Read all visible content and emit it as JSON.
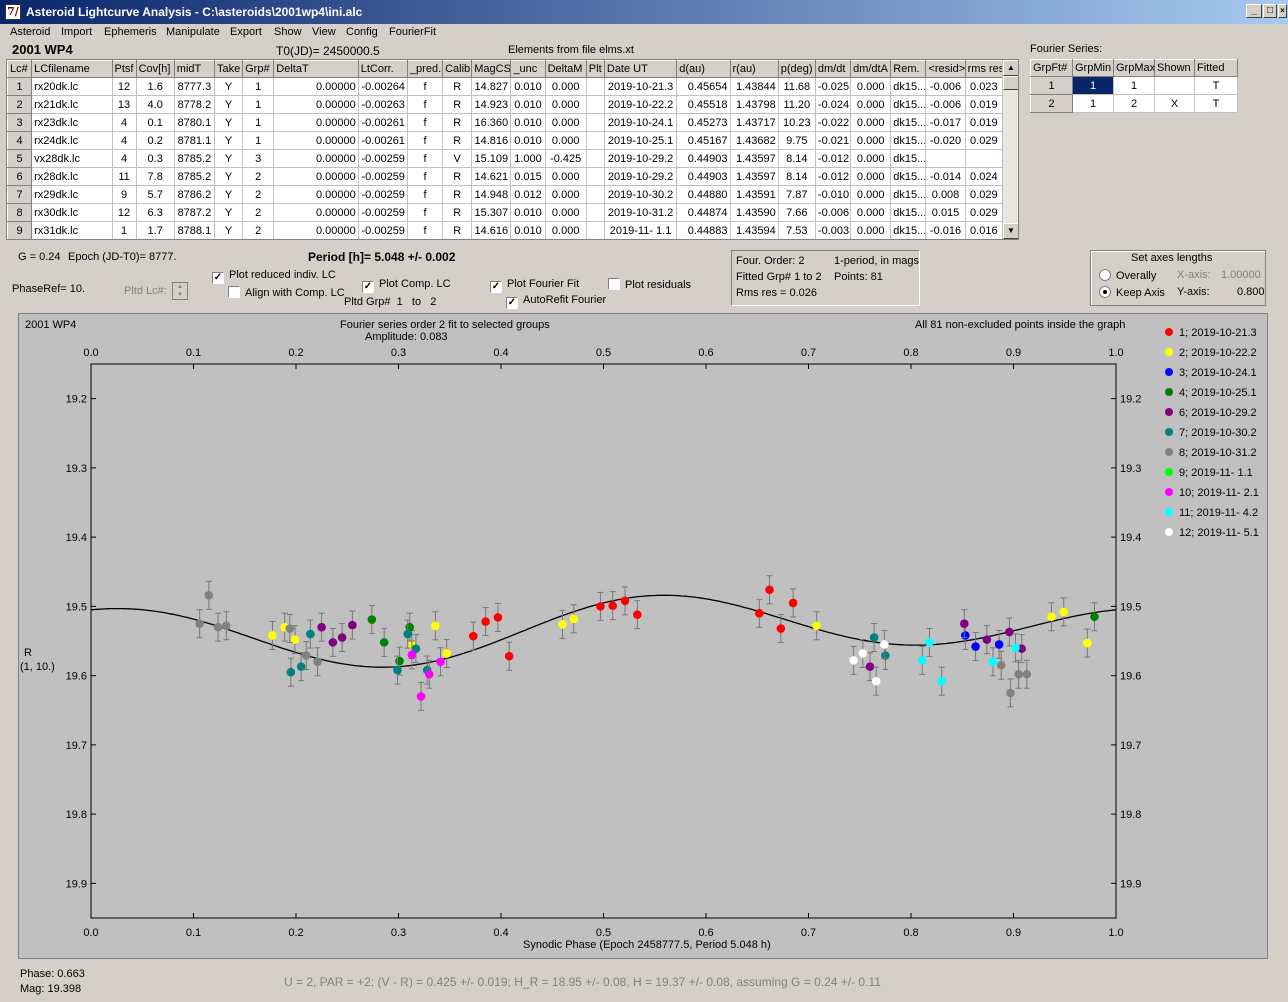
{
  "window": {
    "title": "Asteroid Lightcurve Analysis - C:\\asteroids\\2001wp4\\ini.alc",
    "icon_text": "7/"
  },
  "menu": [
    "Asteroid",
    "Import",
    "Ephemeris",
    "Manipulate",
    "Export",
    "Show",
    "View",
    "Config",
    "FourierFit"
  ],
  "header": {
    "asteroid": "2001 WP4",
    "t0": "T0(JD)= 2450000.5",
    "elements": "Elements from file elms.xt",
    "fourier_series_label": "Fourier Series:"
  },
  "lc_table": {
    "columns": [
      "Lc#",
      "LCfilename",
      "Ptsf",
      "Cov[h]",
      "midT",
      "Take",
      "Grp#",
      "DeltaT",
      "LtCorr.",
      "_pred.",
      "Calib.",
      "MagCS",
      "_unc",
      "DeltaM",
      "Plt",
      "Date UT",
      "d(au)",
      "r(au)",
      "p(deg)",
      "dm/dt",
      "dm/dtA",
      "Rem.",
      "<resid>",
      "rms res"
    ],
    "rows": [
      [
        "1",
        "rx20dk.lc",
        "12",
        "1.6",
        "8777.3",
        "Y",
        "1",
        "0.00000",
        "-0.00264",
        "f",
        "R",
        "14.827",
        "0.010",
        "0.000",
        "",
        "2019-10-21.3",
        "0.45654",
        "1.43844",
        "11.68",
        "-0.025",
        "0.000",
        "dk15...",
        "-0.006",
        "0.023"
      ],
      [
        "2",
        "rx21dk.lc",
        "13",
        "4.0",
        "8778.2",
        "Y",
        "1",
        "0.00000",
        "-0.00263",
        "f",
        "R",
        "14.923",
        "0.010",
        "0.000",
        "",
        "2019-10-22.2",
        "0.45518",
        "1.43798",
        "11.20",
        "-0.024",
        "0.000",
        "dk15...",
        "-0.006",
        "0.019"
      ],
      [
        "3",
        "rx23dk.lc",
        "4",
        "0.1",
        "8780.1",
        "Y",
        "1",
        "0.00000",
        "-0.00261",
        "f",
        "R",
        "16.360",
        "0.010",
        "0.000",
        "",
        "2019-10-24.1",
        "0.45273",
        "1.43717",
        "10.23",
        "-0.022",
        "0.000",
        "dk15...",
        "-0.017",
        "0.019"
      ],
      [
        "4",
        "rx24dk.lc",
        "4",
        "0.2",
        "8781.1",
        "Y",
        "1",
        "0.00000",
        "-0.00261",
        "f",
        "R",
        "14.816",
        "0.010",
        "0.000",
        "",
        "2019-10-25.1",
        "0.45167",
        "1.43682",
        "9.75",
        "-0.021",
        "0.000",
        "dk15...",
        "-0.020",
        "0.029"
      ],
      [
        "5",
        "vx28dk.lc",
        "4",
        "0.3",
        "8785.2",
        "Y",
        "3",
        "0.00000",
        "-0.00259",
        "f",
        "V",
        "15.109",
        "1.000",
        "-0.425",
        "",
        "2019-10-29.2",
        "0.44903",
        "1.43597",
        "8.14",
        "-0.012",
        "0.000",
        "dk15...",
        "",
        ""
      ],
      [
        "6",
        "rx28dk.lc",
        "11",
        "7.8",
        "8785.2",
        "Y",
        "2",
        "0.00000",
        "-0.00259",
        "f",
        "R",
        "14.621",
        "0.015",
        "0.000",
        "",
        "2019-10-29.2",
        "0.44903",
        "1.43597",
        "8.14",
        "-0.012",
        "0.000",
        "dk15...",
        "-0.014",
        "0.024"
      ],
      [
        "7",
        "rx29dk.lc",
        "9",
        "5.7",
        "8786.2",
        "Y",
        "2",
        "0.00000",
        "-0.00259",
        "f",
        "R",
        "14.948",
        "0.012",
        "0.000",
        "",
        "2019-10-30.2",
        "0.44880",
        "1.43591",
        "7.87",
        "-0.010",
        "0.000",
        "dk15...",
        "0.008",
        "0.029"
      ],
      [
        "8",
        "rx30dk.lc",
        "12",
        "6.3",
        "8787.2",
        "Y",
        "2",
        "0.00000",
        "-0.00259",
        "f",
        "R",
        "15.307",
        "0.010",
        "0.000",
        "",
        "2019-10-31.2",
        "0.44874",
        "1.43590",
        "7.66",
        "-0.006",
        "0.000",
        "dk15...",
        "0.015",
        "0.029"
      ],
      [
        "9",
        "rx31dk.lc",
        "1",
        "1.7",
        "8788.1",
        "Y",
        "2",
        "0.00000",
        "-0.00259",
        "f",
        "R",
        "14.616",
        "0.010",
        "0.000",
        "",
        "2019-11- 1.1",
        "0.44883",
        "1.43594",
        "7.53",
        "-0.003",
        "0.000",
        "dk15...",
        "-0.016",
        "0.016"
      ]
    ]
  },
  "fourier_table": {
    "columns": [
      "GrpFt#",
      "GrpMin",
      "GrpMax",
      "Shown",
      "Fitted"
    ],
    "rows": [
      [
        "1",
        "1",
        "1",
        "",
        "T"
      ],
      [
        "2",
        "1",
        "2",
        "X",
        "T"
      ]
    ]
  },
  "controls": {
    "g_text": "G = 0.24",
    "epoch_text": "Epoch (JD-T0)= 8777.",
    "period_text": "Period [h]= 5.048 +/- 0.002",
    "phaseref_text": "PhaseRef= 10.",
    "pltd_lc_label": "Pltd Lc#:",
    "plot_reduced": "Plot reduced indiv. LC",
    "align_comp": "Align with Comp. LC",
    "plot_comp": "Plot Comp. LC",
    "pltd_grp": "Pltd Grp#",
    "grp_from": "1",
    "grp_to_label": "to",
    "grp_to": "2",
    "plot_fourier": "Plot Fourier Fit",
    "autorefit": "AutoRefit Fourier",
    "plot_residuals": "Plot residuals"
  },
  "fourier_info": {
    "order": "Four. Order:  2",
    "period_mode": "1-period, in mags",
    "fitted_grp": "Fitted Grp# 1 to 2",
    "points": "Points: 81",
    "rms": "Rms res      = 0.026"
  },
  "axes_box": {
    "title": "Set axes lengths",
    "overally": "Overally",
    "keep_axis": "Keep Axis",
    "x_axis_label": "X-axis:",
    "x_axis_value": "1.00000",
    "y_axis_label": "Y-axis:",
    "y_axis_value": "0.800"
  },
  "plot": {
    "name": "2001 WP4",
    "subtitle1": "Fourier series order 2 fit to selected groups",
    "subtitle2": "Amplitude: 0.083",
    "note": "All 81 non-excluded points inside the graph",
    "ylabel1": "R",
    "ylabel2": "(1, 10.)",
    "xlabel": "Synodic Phase (Epoch 2458777.5, Period 5.048 h)"
  },
  "status": {
    "phase": "Phase:  0.663",
    "mag": "Mag:    19.398",
    "summary": "U = 2, PAR = +2; (V - R) = 0.425 +/- 0.019; H_R = 18.95 +/- 0.08, H = 19.37 +/- 0.08, assuming G = 0.24 +/- 0.11"
  },
  "chart_data": {
    "type": "scatter",
    "title": "2001 WP4",
    "xlabel": "Synodic Phase (Epoch 2458777.5, Period 5.048 h)",
    "ylabel": "R",
    "xlim": [
      0.0,
      1.0
    ],
    "ylim": [
      19.15,
      19.95
    ],
    "y_inverted": true,
    "xticks": [
      0.0,
      0.1,
      0.2,
      0.3,
      0.4,
      0.5,
      0.6,
      0.7,
      0.8,
      0.9,
      1.0
    ],
    "yticks": [
      19.2,
      19.3,
      19.4,
      19.5,
      19.6,
      19.7,
      19.8,
      19.9
    ],
    "grid": false,
    "legend_position": "right",
    "fit": {
      "mean": 19.533,
      "a1": 0.005,
      "b1": 0.018,
      "a2": -0.033,
      "b2": -0.02
    },
    "series": [
      {
        "name": "1; 2019-10-21.3",
        "color": "#ff0000",
        "x": [
          0.373,
          0.385,
          0.397,
          0.408,
          0.497,
          0.509,
          0.521,
          0.533,
          0.652,
          0.662,
          0.673,
          0.685
        ],
        "y": [
          19.543,
          19.522,
          19.516,
          19.572,
          19.5,
          19.499,
          19.492,
          19.512,
          19.51,
          19.476,
          19.532,
          19.495
        ]
      },
      {
        "name": "2; 2019-10-22.2",
        "color": "#ffff00",
        "x": [
          0.177,
          0.189,
          0.199,
          0.313,
          0.336,
          0.347,
          0.46,
          0.471,
          0.708,
          0.937,
          0.949,
          0.972
        ],
        "y": [
          19.542,
          19.53,
          19.548,
          19.555,
          19.528,
          19.568,
          19.526,
          19.518,
          19.528,
          19.515,
          19.508,
          19.553
        ]
      },
      {
        "name": "3; 2019-10-24.1",
        "color": "#0000ff",
        "x": [
          0.853,
          0.863,
          0.886
        ],
        "y": [
          19.542,
          19.558,
          19.555
        ]
      },
      {
        "name": "4; 2019-10-25.1",
        "color": "#008000",
        "x": [
          0.274,
          0.286,
          0.301,
          0.311,
          0.979
        ],
        "y": [
          19.519,
          19.552,
          19.579,
          19.53,
          19.515
        ]
      },
      {
        "name": "6; 2019-10-29.2",
        "color": "#800080",
        "x": [
          0.225,
          0.236,
          0.245,
          0.255,
          0.76,
          0.852,
          0.874,
          0.896,
          0.908
        ],
        "y": [
          19.53,
          19.552,
          19.545,
          19.527,
          19.587,
          19.525,
          19.548,
          19.537,
          19.561
        ]
      },
      {
        "name": "7; 2019-10-30.2",
        "color": "#008080",
        "x": [
          0.195,
          0.205,
          0.214,
          0.299,
          0.309,
          0.317,
          0.328,
          0.764,
          0.775
        ],
        "y": [
          19.595,
          19.587,
          19.54,
          19.592,
          19.54,
          19.561,
          19.592,
          19.545,
          19.571
        ]
      },
      {
        "name": "8; 2019-10-31.2",
        "color": "#808080",
        "x": [
          0.106,
          0.115,
          0.124,
          0.132,
          0.194,
          0.21,
          0.221,
          0.888,
          0.897,
          0.905,
          0.913
        ],
        "y": [
          19.525,
          19.484,
          19.53,
          19.528,
          19.532,
          19.571,
          19.58,
          19.585,
          19.625,
          19.598,
          19.598
        ]
      },
      {
        "name": "9; 2019-11- 1.1",
        "color": "#00ff00",
        "x": [],
        "y": []
      },
      {
        "name": "10; 2019-11- 2.1",
        "color": "#ff00ff",
        "x": [
          0.313,
          0.322,
          0.33,
          0.341
        ],
        "y": [
          19.57,
          19.63,
          19.598,
          19.58
        ]
      },
      {
        "name": "11; 2019-11- 4.2",
        "color": "#00ffff",
        "x": [
          0.811,
          0.818,
          0.83,
          0.88,
          0.902
        ],
        "y": [
          19.578,
          19.552,
          19.608,
          19.58,
          19.56
        ]
      },
      {
        "name": "12; 2019-11- 5.1",
        "color": "#ffffff",
        "x": [
          0.744,
          0.753,
          0.766,
          0.774
        ],
        "y": [
          19.578,
          19.568,
          19.608,
          19.555
        ]
      }
    ]
  }
}
